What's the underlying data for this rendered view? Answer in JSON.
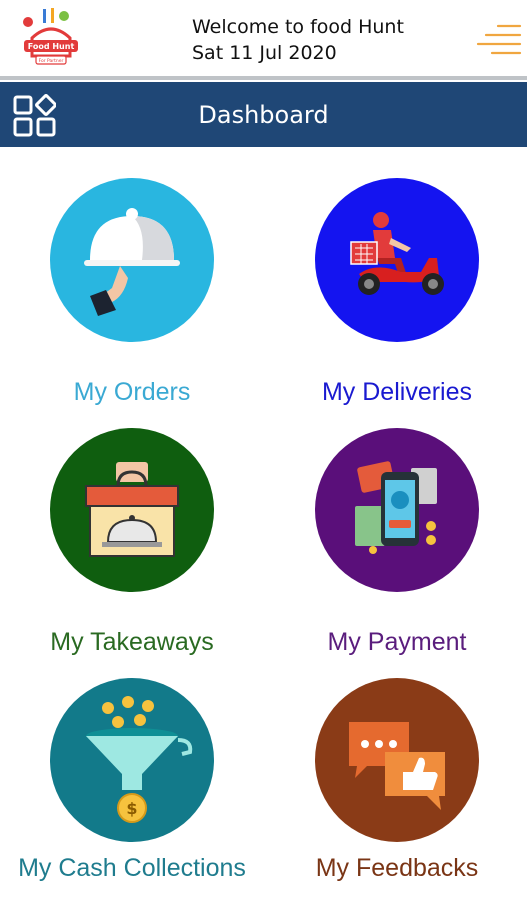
{
  "header": {
    "welcome": "Welcome to food Hunt",
    "date": "Sat 11 Jul 2020",
    "logo_text": "Food Hunt",
    "logo_subtext": "For Partner",
    "menu_icon": "hamburger-menu-icon"
  },
  "navbar": {
    "title": "Dashboard",
    "grid_icon": "grid-icon"
  },
  "tiles": [
    {
      "label": "My Orders",
      "color": "#29b6e0",
      "text_color": "#3aa9d3",
      "icon": "serving-cloche-icon"
    },
    {
      "label": "My Deliveries",
      "color": "#1414f0",
      "text_color": "#1a1ad0",
      "icon": "delivery-scooter-icon"
    },
    {
      "label": "My Takeaways",
      "color": "#0f5e0f",
      "text_color": "#2a6a22",
      "icon": "takeaway-box-icon"
    },
    {
      "label": "My Payment",
      "color": "#5a0f7a",
      "text_color": "#5a1d7d",
      "icon": "mobile-payment-icon"
    },
    {
      "label": "My Cash Collections",
      "color": "#127a8a",
      "text_color": "#1f7c8e",
      "icon": "cash-funnel-icon"
    },
    {
      "label": "My Feedbacks",
      "color": "#8a3b17",
      "text_color": "#7a3515",
      "icon": "feedback-chat-icon"
    }
  ]
}
